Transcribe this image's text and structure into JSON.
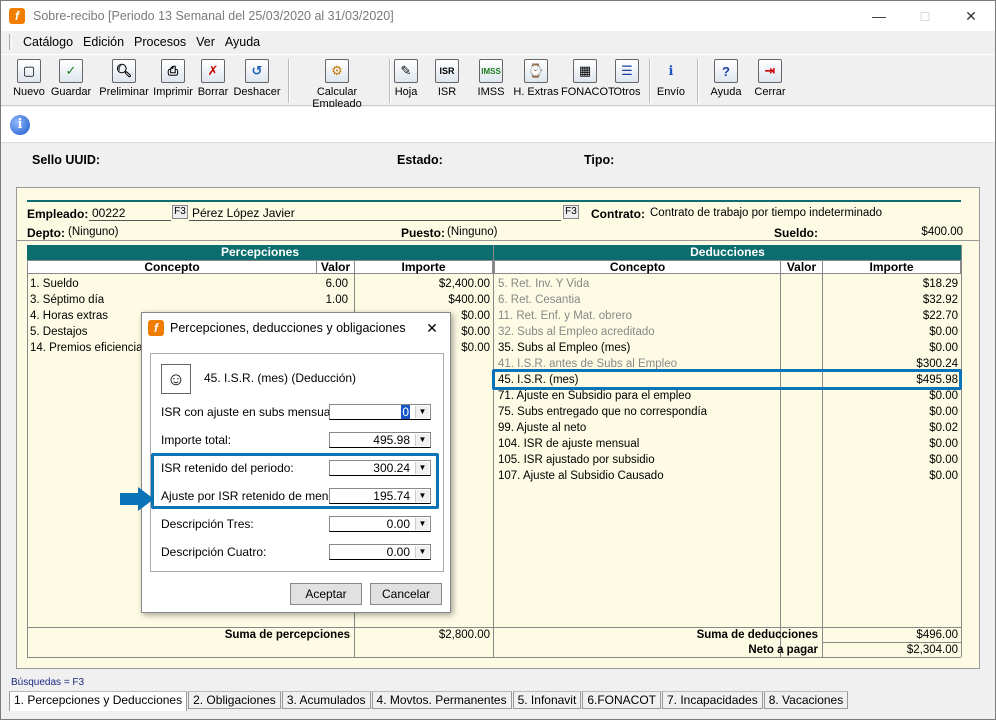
{
  "window": {
    "title": "Sobre-recibo  [Periodo 13 Semanal del 25/03/2020 al 31/03/2020]"
  },
  "menu": [
    "Catálogo",
    "Edición",
    "Procesos",
    "Ver",
    "Ayuda"
  ],
  "toolbar": [
    {
      "label": "Nuevo",
      "icon": "new-doc-icon"
    },
    {
      "label": "Guardar",
      "icon": "check-icon"
    },
    {
      "label": "Preliminar",
      "icon": "preview-icon"
    },
    {
      "label": "Imprimir",
      "icon": "printer-icon"
    },
    {
      "label": "Borrar",
      "icon": "delete-x-icon"
    },
    {
      "label": "Deshacer",
      "icon": "undo-icon"
    },
    {
      "label": "Calcular Empleado",
      "icon": "calculate-icon"
    },
    {
      "label": "Hoja",
      "icon": "sheet-icon"
    },
    {
      "label": "ISR",
      "icon": "isr-icon"
    },
    {
      "label": "IMSS",
      "icon": "imss-icon"
    },
    {
      "label": "H. Extras",
      "icon": "extra-hours-icon"
    },
    {
      "label": "FONACOT",
      "icon": "fonacot-icon"
    },
    {
      "label": "Otros",
      "icon": "others-icon"
    },
    {
      "label": "Envío",
      "icon": "send-icon"
    },
    {
      "label": "Ayuda",
      "icon": "help-icon"
    },
    {
      "label": "Cerrar",
      "icon": "exit-icon"
    }
  ],
  "header": {
    "sello_uuid": "Sello UUID:",
    "estado": "Estado:",
    "tipo": "Tipo:"
  },
  "employee": {
    "empleado_lbl": "Empleado:",
    "empleado_id": "00222",
    "f3": "F3",
    "nombre": "Pérez López Javier",
    "contrato_lbl": "Contrato:",
    "contrato": "Contrato de trabajo por tiempo indeterminado",
    "depto_lbl": "Depto:",
    "depto": "(Ninguno)",
    "puesto_lbl": "Puesto:",
    "puesto": "(Ninguno)",
    "sueldo_lbl": "Sueldo:",
    "sueldo": "$400.00"
  },
  "percepciones": {
    "title": "Percepciones",
    "cols": [
      "Concepto",
      "Valor",
      "Importe"
    ],
    "rows": [
      {
        "concepto": "1. Sueldo",
        "valor": "6.00",
        "importe": "$2,400.00"
      },
      {
        "concepto": "3. Séptimo día",
        "valor": "1.00",
        "importe": "$400.00"
      },
      {
        "concepto": "4. Horas extras",
        "valor": "",
        "importe": "$0.00"
      },
      {
        "concepto": "5. Destajos",
        "valor": "",
        "importe": "$0.00"
      },
      {
        "concepto": "14. Premios eficiencia",
        "valor": "",
        "importe": "$0.00"
      }
    ],
    "suma_lbl": "Suma de percepciones",
    "suma": "$2,800.00"
  },
  "deducciones": {
    "title": "Deducciones",
    "cols": [
      "Concepto",
      "Valor",
      "Importe"
    ],
    "rows": [
      {
        "concepto": "5. Ret. Inv. Y Vida",
        "importe": "$18.29",
        "grey": true
      },
      {
        "concepto": "6. Ret. Cesantia",
        "importe": "$32.92",
        "grey": true
      },
      {
        "concepto": "11. Ret. Enf. y Mat. obrero",
        "importe": "$22.70",
        "grey": true
      },
      {
        "concepto": "32. Subs al Empleo acreditado",
        "importe": "$0.00",
        "grey": true
      },
      {
        "concepto": "35. Subs al Empleo (mes)",
        "importe": "$0.00",
        "grey": false
      },
      {
        "concepto": "41. I.S.R. antes de Subs al Empleo",
        "importe": "$300.24",
        "grey": true
      },
      {
        "concepto": "45. I.S.R. (mes)",
        "importe": "$495.98",
        "grey": false
      },
      {
        "concepto": "71. Ajuste en Subsidio para el empleo",
        "importe": "$0.00",
        "grey": false
      },
      {
        "concepto": "75. Subs entregado que no correspondía",
        "importe": "$0.00",
        "grey": false
      },
      {
        "concepto": "99. Ajuste al neto",
        "importe": "$0.02",
        "grey": false
      },
      {
        "concepto": "104. ISR de ajuste mensual",
        "importe": "$0.00",
        "grey": false
      },
      {
        "concepto": "105. ISR ajustado por subsidio",
        "importe": "$0.00",
        "grey": false
      },
      {
        "concepto": "107. Ajuste al Subsidio Causado",
        "importe": "$0.00",
        "grey": false
      }
    ],
    "suma_lbl": "Suma de deducciones",
    "suma": "$496.00",
    "neto_lbl": "Neto a pagar",
    "neto": "$2,304.00"
  },
  "busquedas": "Búsquedas = F3",
  "tabs": [
    "1. Percepciones y Deducciones",
    "2. Obligaciones",
    "3. Acumulados",
    "4. Movtos. Permanentes",
    "5. Infonavit",
    "6.FONACOT",
    "7. Incapacidades",
    "8. Vacaciones"
  ],
  "dialog": {
    "title": "Percepciones, deducciones y obligaciones",
    "concept": "45. I.S.R. (mes) (Deducción)",
    "fields": [
      {
        "label": "ISR con ajuste en subs mensual:",
        "value": "0"
      },
      {
        "label": "Importe total:",
        "value": "495.98"
      },
      {
        "label": "ISR retenido del periodo:",
        "value": "300.24"
      },
      {
        "label": "Ajuste por ISR retenido de menos:",
        "value": "195.74"
      },
      {
        "label": "Descripción Tres:",
        "value": "0.00"
      },
      {
        "label": "Descripción Cuatro:",
        "value": "0.00"
      }
    ],
    "accept": "Aceptar",
    "cancel": "Cancelar"
  }
}
